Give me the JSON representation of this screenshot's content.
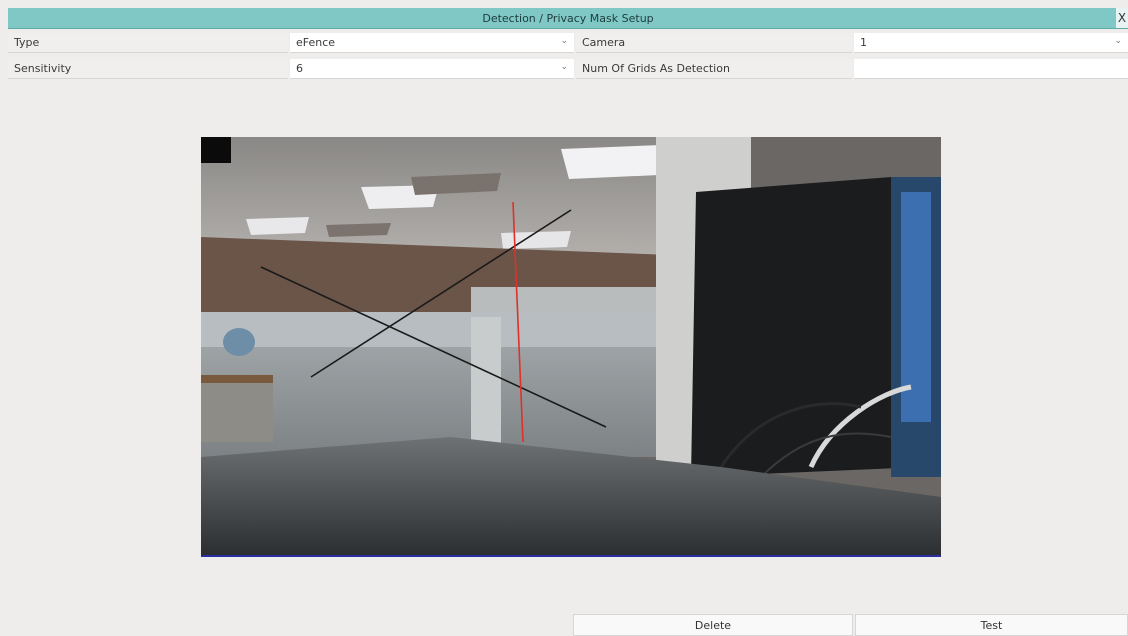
{
  "window": {
    "title": "Detection / Privacy Mask Setup",
    "close_label": "X"
  },
  "fields": {
    "type": {
      "label": "Type",
      "value": "eFence"
    },
    "camera": {
      "label": "Camera",
      "value": "1"
    },
    "sensitivity": {
      "label": "Sensitivity",
      "value": "6"
    },
    "num_grids": {
      "label": "Num Of Grids As Detection",
      "value": ""
    }
  },
  "buttons": {
    "delete": "Delete",
    "test": "Test"
  },
  "colors": {
    "titlebar": "#7fc8c6",
    "fence_line": "#e0302a",
    "cross_lines": "#1a1a1a",
    "preview_border": "#2a2ea0"
  }
}
